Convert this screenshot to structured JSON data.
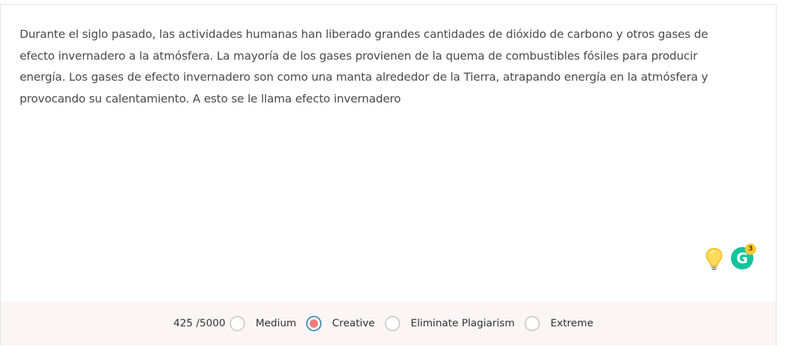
{
  "editor": {
    "text": "Durante el siglo pasado, las actividades humanas han liberado grandes cantidades de dióxido de carbono y otros gases de efecto invernadero a la atmósfera. La mayoría de los gases provienen de la quema de combustibles fósiles para producir energía. Los gases de efecto invernadero son como una manta alrededor de la Tierra, atrapando energía en la atmósfera y provocando su calentamiento. A esto se le llama efecto invernadero"
  },
  "icons": {
    "bulb": "lightbulb-icon",
    "grammarly": "grammarly-icon",
    "grammarly_letter": "G",
    "grammarly_badge_count": "3"
  },
  "footer": {
    "counter": "425 /5000",
    "modes": [
      {
        "label": "Medium",
        "selected": false
      },
      {
        "label": "Creative",
        "selected": true
      },
      {
        "label": "Eliminate Plagiarism",
        "selected": false
      },
      {
        "label": "Extreme",
        "selected": false
      }
    ]
  },
  "colors": {
    "text": "#4a4a4a",
    "footer_bg": "#fbf5f6",
    "radio_selected_ring": "#4a90b8",
    "radio_selected_dot": "#f07b7b",
    "grammarly_green": "#15c39a",
    "badge_yellow": "#ffc933"
  }
}
